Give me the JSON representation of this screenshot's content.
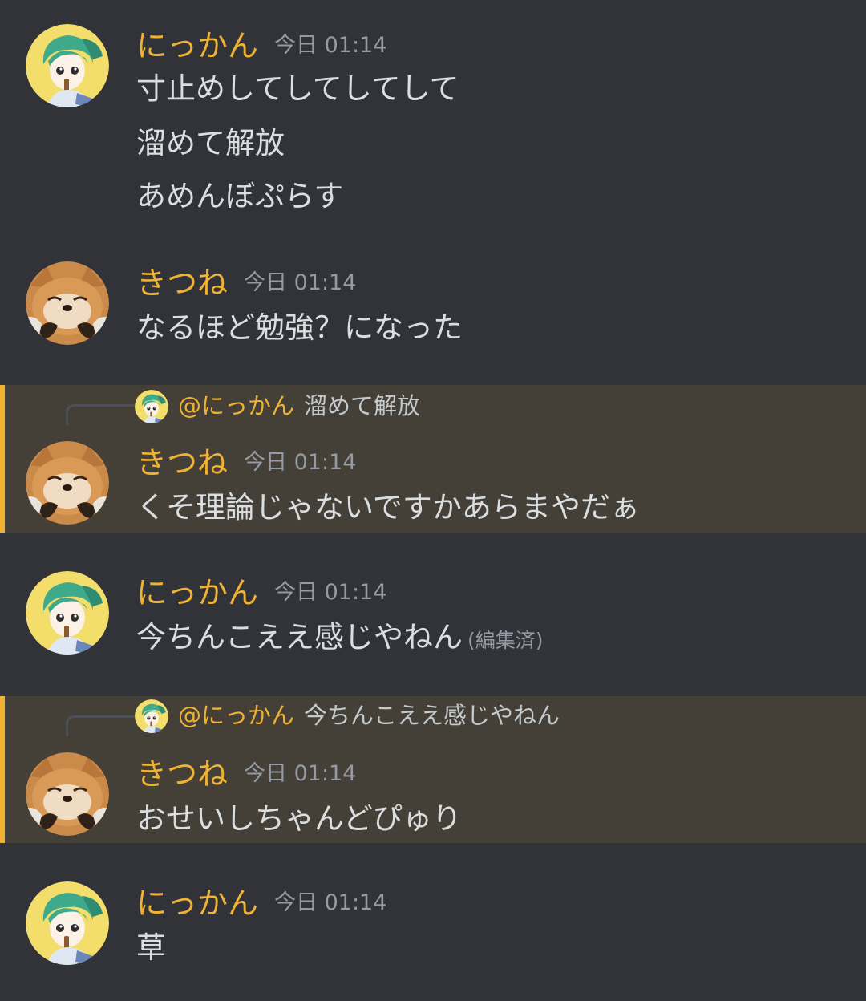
{
  "colors": {
    "background": "#313338",
    "author_name": "#f0b232",
    "highlight_bg": "#444037",
    "highlight_bar": "#f0b232",
    "timestamp": "#949ba4"
  },
  "messages": [
    {
      "author": "にっかん",
      "timestamp": "今日 01:14",
      "avatar": "green-hair-anime-avatar",
      "lines": [
        "寸止めしてしてしてして",
        "溜めて解放",
        "あめんぼぷらす"
      ]
    },
    {
      "author": "きつね",
      "timestamp": "今日 01:14",
      "avatar": "fox-avatar",
      "lines": [
        "なるほど勉強？になった"
      ]
    },
    {
      "author": "きつね",
      "timestamp": "今日 01:14",
      "avatar": "fox-avatar",
      "reply": {
        "name": "@にっかん",
        "content": "溜めて解放"
      },
      "lines": [
        "くそ理論じゃないですかあらまやだぁ"
      ]
    },
    {
      "author": "にっかん",
      "timestamp": "今日 01:14",
      "avatar": "green-hair-anime-avatar",
      "lines": [
        "今ちんこええ感じやねん"
      ],
      "edited_label": "(編集済)"
    },
    {
      "author": "きつね",
      "timestamp": "今日 01:14",
      "avatar": "fox-avatar",
      "reply": {
        "name": "@にっかん",
        "content": "今ちんこええ感じやねん"
      },
      "lines": [
        "おせいしちゃんどぴゅり"
      ]
    },
    {
      "author": "にっかん",
      "timestamp": "今日 01:14",
      "avatar": "green-hair-anime-avatar",
      "lines": [
        "草"
      ]
    }
  ]
}
